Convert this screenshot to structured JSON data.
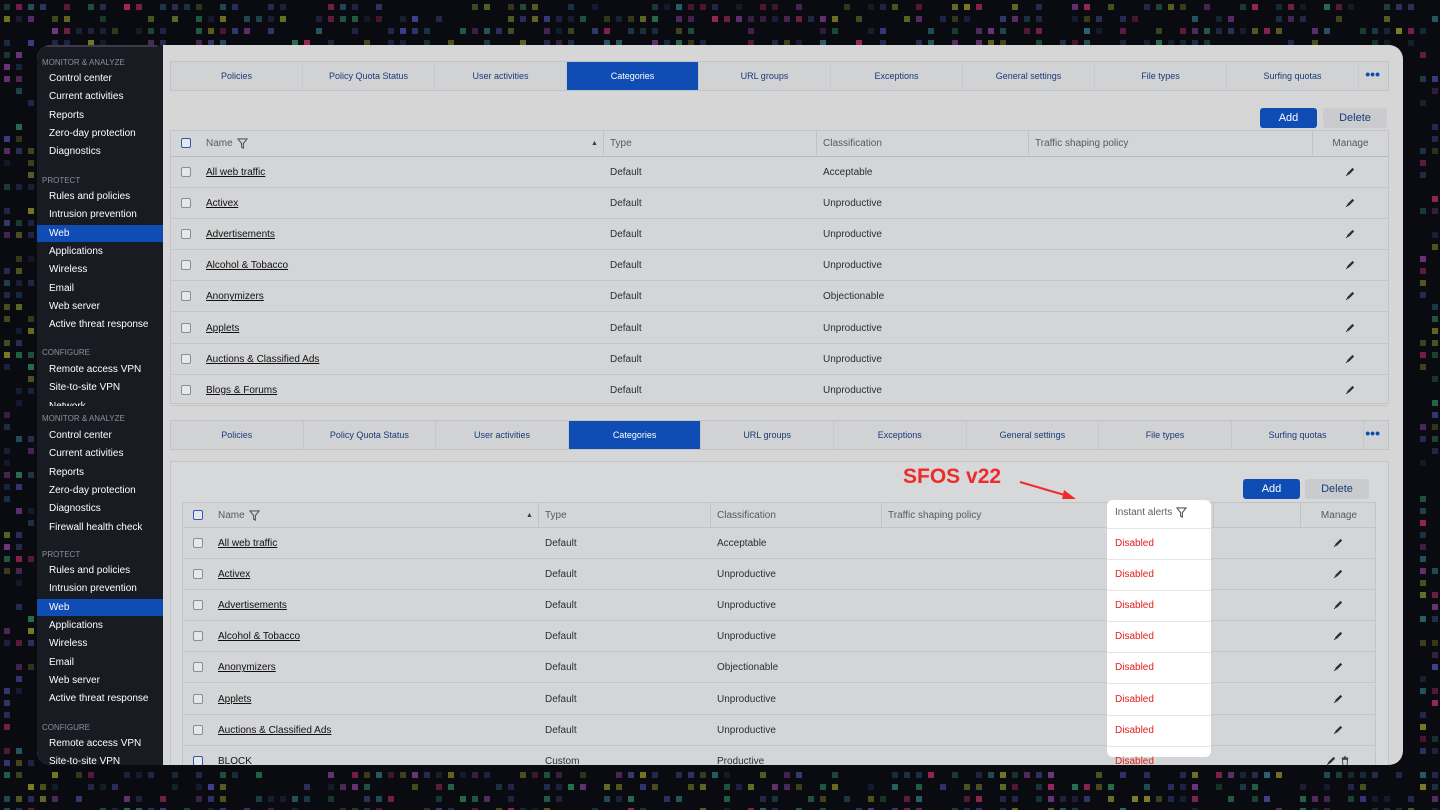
{
  "colors": {
    "accent": "#0f4cb3",
    "disabled_text": "#e0201c",
    "annotation": "#ee2b2b",
    "sidebar_bg": "#191b22"
  },
  "sidebar": {
    "sections": [
      {
        "title": "MONITOR & ANALYZE",
        "items": [
          "Control center",
          "Current activities",
          "Reports",
          "Zero-day protection",
          "Diagnostics"
        ]
      },
      {
        "title": "PROTECT",
        "items": [
          "Rules and policies",
          "Intrusion prevention",
          "Web",
          "Applications",
          "Wireless",
          "Email",
          "Web server",
          "Active threat response"
        ]
      },
      {
        "title": "CONFIGURE",
        "items": [
          "Remote access VPN",
          "Site-to-site VPN"
        ],
        "clipped": "Network"
      },
      {
        "title": "MONITOR & ANALYZE",
        "items": [
          "Control center",
          "Current activities",
          "Reports",
          "Zero-day protection",
          "Diagnostics",
          "Firewall health check"
        ]
      },
      {
        "title": "PROTECT",
        "items": [
          "Rules and policies",
          "Intrusion prevention",
          "Web",
          "Applications",
          "Wireless",
          "Email",
          "Web server",
          "Active threat response"
        ]
      },
      {
        "title": "CONFIGURE",
        "items": [
          "Remote access VPN",
          "Site-to-site VPN"
        ]
      }
    ],
    "active_item": "Web"
  },
  "tabs": [
    "Policies",
    "Policy Quota Status",
    "User activities",
    "Categories",
    "URL groups",
    "Exceptions",
    "General settings",
    "File types",
    "Surfing quotas"
  ],
  "active_tab": "Categories",
  "more_icon": "ellipsis-icon",
  "buttons": {
    "add": "Add",
    "delete": "Delete"
  },
  "table_top": {
    "columns": {
      "name": "Name",
      "type": "Type",
      "classification": "Classification",
      "traffic": "Traffic shaping policy",
      "manage": "Manage"
    },
    "rows": [
      {
        "name": "All web traffic",
        "type": "Default",
        "classification": "Acceptable"
      },
      {
        "name": "Activex",
        "type": "Default",
        "classification": "Unproductive"
      },
      {
        "name": "Advertisements",
        "type": "Default",
        "classification": "Unproductive"
      },
      {
        "name": "Alcohol & Tobacco",
        "type": "Default",
        "classification": "Unproductive"
      },
      {
        "name": "Anonymizers",
        "type": "Default",
        "classification": "Objectionable"
      },
      {
        "name": "Applets",
        "type": "Default",
        "classification": "Unproductive"
      },
      {
        "name": "Auctions & Classified Ads",
        "type": "Default",
        "classification": "Unproductive"
      },
      {
        "name": "Blogs & Forums",
        "type": "Default",
        "classification": "Unproductive"
      }
    ]
  },
  "table_bottom": {
    "columns": {
      "name": "Name",
      "type": "Type",
      "classification": "Classification",
      "traffic": "Traffic shaping policy",
      "alerts": "Instant alerts",
      "manage": "Manage"
    },
    "rows": [
      {
        "name": "All web traffic",
        "type": "Default",
        "classification": "Acceptable",
        "alerts": "Disabled"
      },
      {
        "name": "Activex",
        "type": "Default",
        "classification": "Unproductive",
        "alerts": "Disabled"
      },
      {
        "name": "Advertisements",
        "type": "Default",
        "classification": "Unproductive",
        "alerts": "Disabled"
      },
      {
        "name": "Alcohol & Tobacco",
        "type": "Default",
        "classification": "Unproductive",
        "alerts": "Disabled"
      },
      {
        "name": "Anonymizers",
        "type": "Default",
        "classification": "Objectionable",
        "alerts": "Disabled"
      },
      {
        "name": "Applets",
        "type": "Default",
        "classification": "Unproductive",
        "alerts": "Disabled"
      },
      {
        "name": "Auctions & Classified Ads",
        "type": "Default",
        "classification": "Unproductive",
        "alerts": "Disabled"
      },
      {
        "name": "BLOCK",
        "type": "Custom",
        "classification": "Productive",
        "alerts": "Disabled"
      }
    ]
  },
  "annotation": {
    "label": "SFOS v22"
  }
}
